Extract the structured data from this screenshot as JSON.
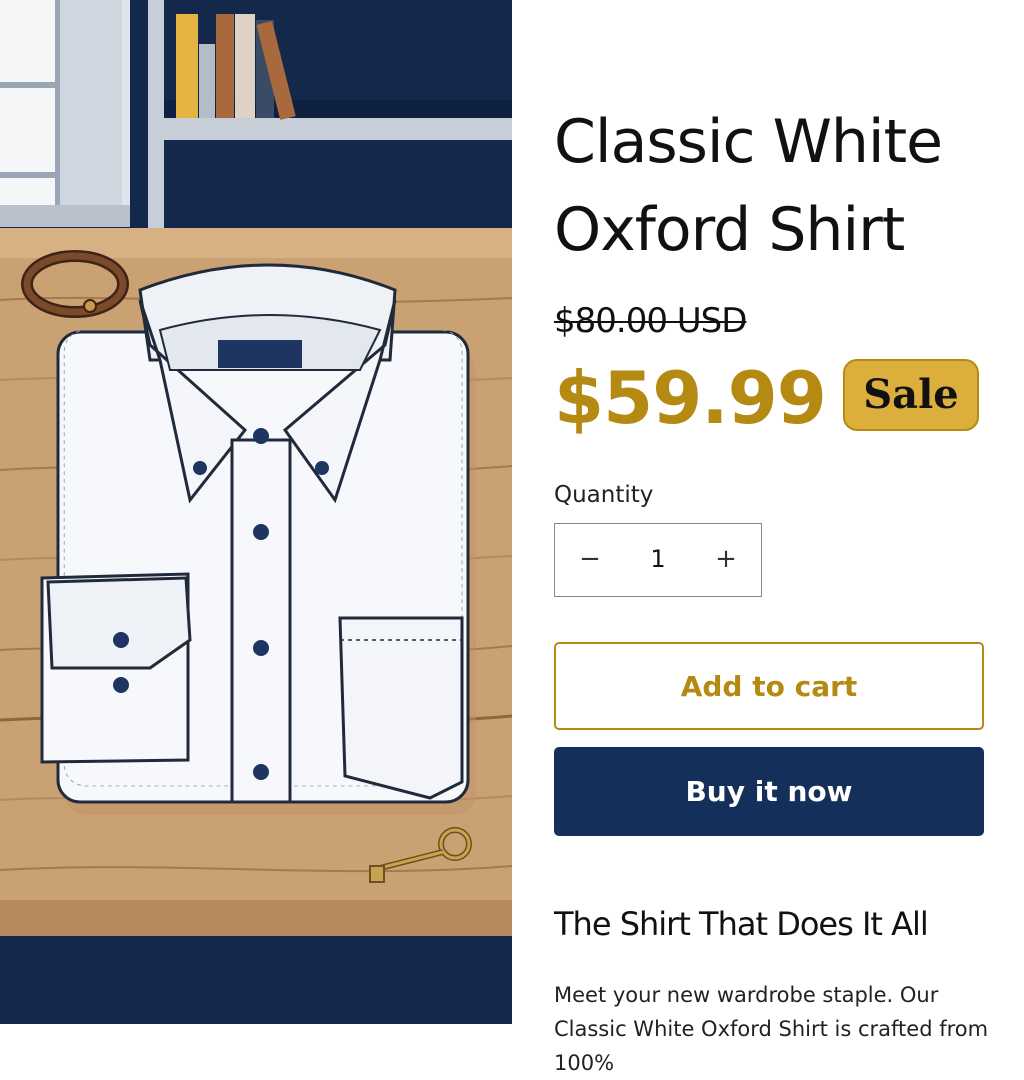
{
  "product": {
    "title": "Classic White Oxford Shirt",
    "compare_price": "$80.00 USD",
    "price": "$59.99",
    "badge": "Sale",
    "image_alt": "Folded classic white oxford shirt on a wooden table"
  },
  "quantity": {
    "label": "Quantity",
    "value": "1",
    "decrease_symbol": "−",
    "increase_symbol": "+"
  },
  "actions": {
    "add_to_cart": "Add to cart",
    "buy_now": "Buy it now"
  },
  "description": {
    "heading": "The Shirt That Does It All",
    "text": "Meet your new wardrobe staple. Our Classic White Oxford Shirt is crafted from 100%"
  },
  "colors": {
    "accent_gold": "#b58a12",
    "badge_gold": "#dcae3c",
    "navy": "#14305a"
  }
}
